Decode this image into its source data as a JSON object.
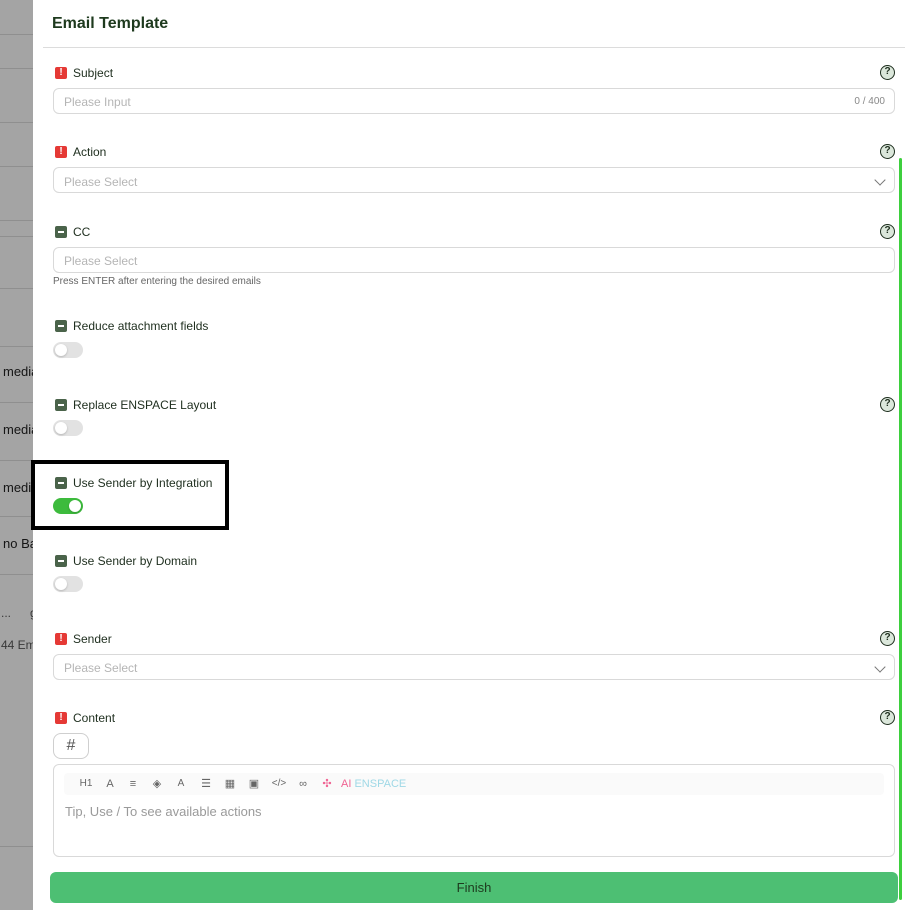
{
  "background": {
    "row_texts": [
      "media",
      "media",
      "media",
      "no Ba"
    ],
    "footer_dots": "...",
    "footer_g": "g",
    "footer_count": "44 Em"
  },
  "drawer": {
    "title": "Email Template",
    "subject": {
      "label": "Subject",
      "placeholder": "Please Input",
      "counter": "0 / 400",
      "required": true
    },
    "action": {
      "label": "Action",
      "placeholder": "Please Select",
      "required": true
    },
    "cc": {
      "label": "CC",
      "placeholder": "Please Select",
      "hint": "Press ENTER after entering the desired emails"
    },
    "reduce_attachment": {
      "label": "Reduce attachment fields",
      "enabled": false
    },
    "replace_layout": {
      "label": "Replace ENSPACE Layout",
      "enabled": false
    },
    "sender_by_integration": {
      "label": "Use Sender by Integration",
      "enabled": true
    },
    "sender_by_domain": {
      "label": "Use Sender by Domain",
      "enabled": false
    },
    "sender": {
      "label": "Sender",
      "placeholder": "Please Select",
      "required": true
    },
    "content": {
      "label": "Content",
      "required": true,
      "hash_button": "#",
      "toolbar": {
        "h1": "H1",
        "font_color": "A",
        "align": "≡",
        "fill": "◈",
        "font_size": "A",
        "list": "☰",
        "table": "▦",
        "image": "▣",
        "code": "</>",
        "link": "∞",
        "ai_icon": "✣",
        "ai_prefix": "AI",
        "ai_brand": "ENSPACE"
      },
      "placeholder": "Tip, Use / To see available actions"
    },
    "help_symbol": "?",
    "required_symbol": "!",
    "finish_label": "Finish"
  },
  "colors": {
    "accent_green": "#4dbf73",
    "switch_on": "#3dbb3d",
    "required_red": "#e53935",
    "scrollbar": "#3dcf3d"
  }
}
